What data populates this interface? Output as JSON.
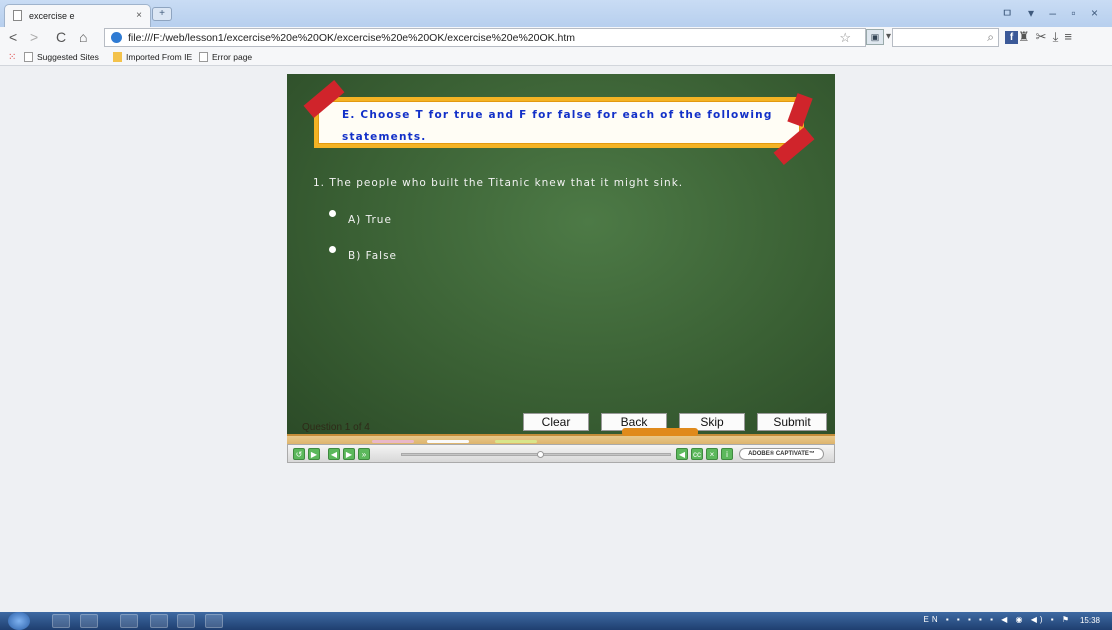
{
  "browser": {
    "tab_title": "excercise e",
    "tab_close": "×",
    "new_tab": "+",
    "window_controls": "ㅁ ▾ – ▫ ×",
    "url": "file:///F:/web/lesson1/excercise%20e%20OK/excercise%20e%20OK/excercise%20e%20OK.htm",
    "extension_caret": "▾",
    "bookmarks": [
      "Suggested Sites",
      "Imported From IE",
      "Error page"
    ]
  },
  "quiz": {
    "instruction": "E. Choose T for true and F for false for each of the following statements.",
    "question": "1. The people who built the Titanic knew that it might sink.",
    "options": [
      "A) True",
      "B) False"
    ],
    "progress": "Question 1 of 4",
    "buttons": {
      "clear": "Clear",
      "back": "Back",
      "skip": "Skip",
      "submit": "Submit"
    }
  },
  "player": {
    "brand": "ADOBE® CAPTIVATE™"
  },
  "taskbar": {
    "lang": "EN",
    "time": "15:38"
  },
  "colors": {
    "instruction_text": "#1230c8",
    "banner_border": "#f4b324",
    "ribbon": "#d0242b",
    "board": "#3a6034"
  }
}
